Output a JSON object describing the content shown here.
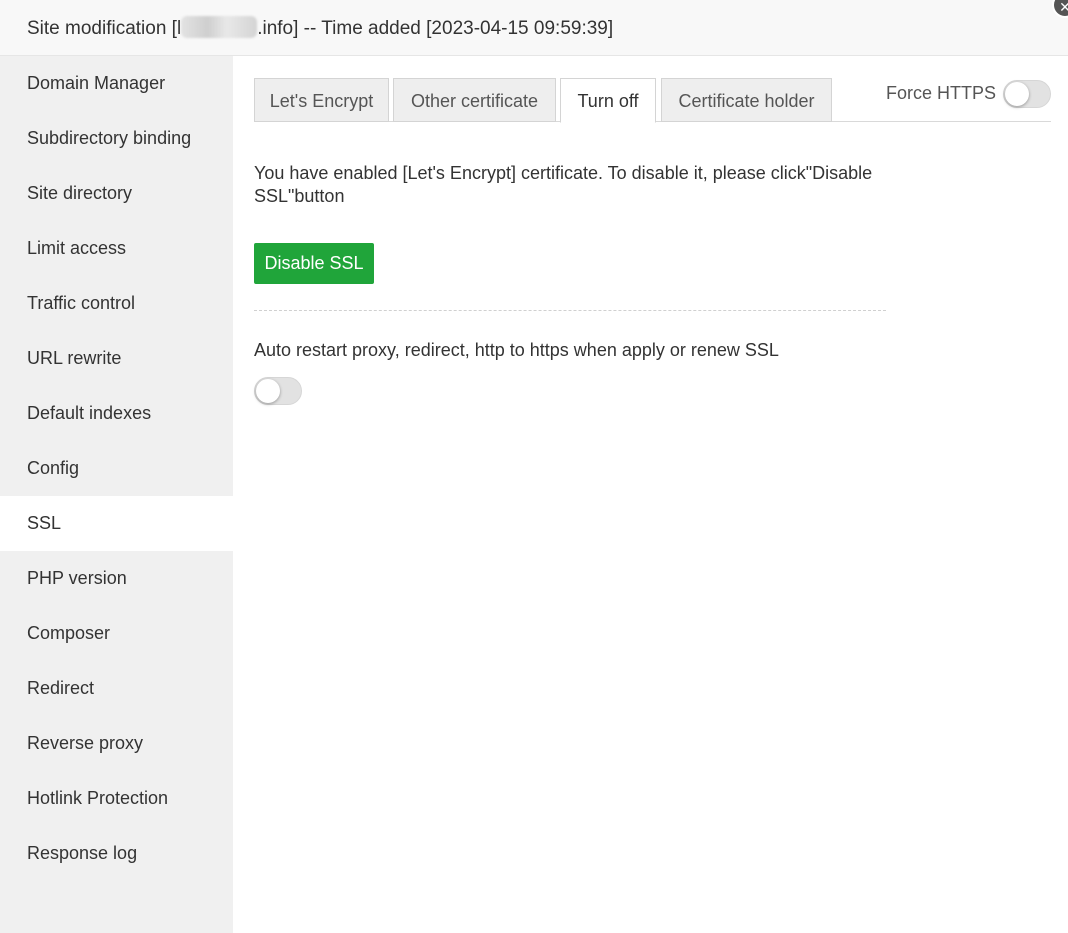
{
  "header": {
    "title_prefix": "Site modification [l",
    "title_suffix": ".info] -- Time added [2023-04-15 09:59:39]",
    "close_glyph": "✕"
  },
  "sidebar": {
    "items": [
      {
        "label": "Domain Manager"
      },
      {
        "label": "Subdirectory binding"
      },
      {
        "label": "Site directory"
      },
      {
        "label": "Limit access"
      },
      {
        "label": "Traffic control"
      },
      {
        "label": "URL rewrite"
      },
      {
        "label": "Default indexes"
      },
      {
        "label": "Config"
      },
      {
        "label": "SSL",
        "active": true
      },
      {
        "label": "PHP version"
      },
      {
        "label": "Composer"
      },
      {
        "label": "Redirect"
      },
      {
        "label": "Reverse proxy"
      },
      {
        "label": "Hotlink Protection"
      },
      {
        "label": "Response log"
      }
    ]
  },
  "tabs": [
    {
      "label": "Let's Encrypt"
    },
    {
      "label": "Other certificate"
    },
    {
      "label": "Turn off",
      "active": true
    },
    {
      "label": "Certificate holder"
    }
  ],
  "force_https": {
    "label": "Force HTTPS",
    "enabled": false
  },
  "ssl_notice": "You have enabled [Let's Encrypt] certificate. To disable it, please click\"Disable SSL\"button",
  "disable_button_label": "Disable SSL",
  "auto_restart": {
    "label": "Auto restart proxy, redirect, http to https when apply or renew SSL",
    "enabled": false
  },
  "colors": {
    "accent_green": "#20a53a",
    "sidebar_bg": "#f0f0f0",
    "header_bg": "#f8f8f8"
  }
}
